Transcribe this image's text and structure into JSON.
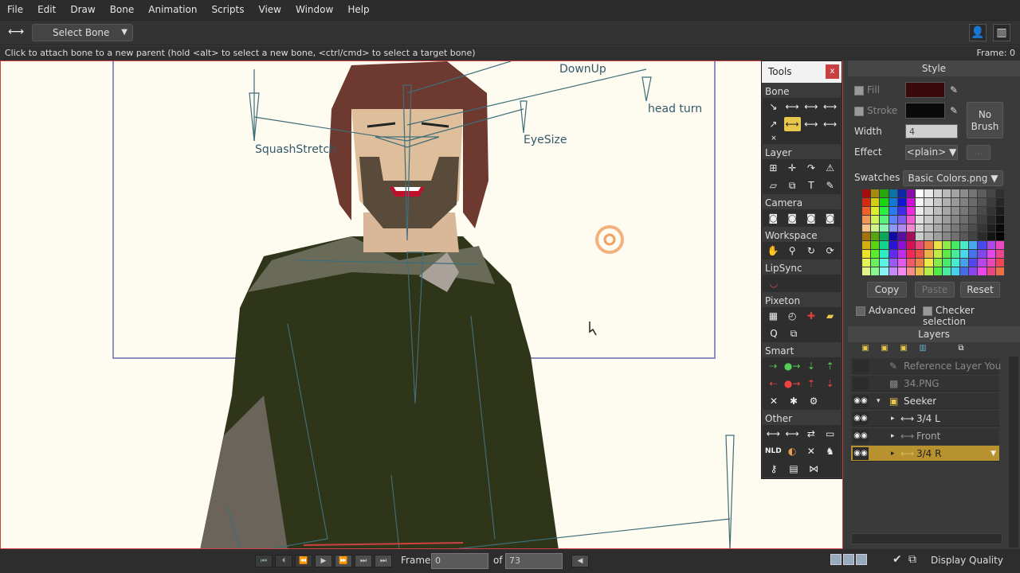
{
  "menu": [
    "File",
    "Edit",
    "Draw",
    "Bone",
    "Animation",
    "Scripts",
    "View",
    "Window",
    "Help"
  ],
  "toolbar": {
    "tool_select": "Select Bone"
  },
  "status": {
    "hint": "Click to attach bone to a new parent (hold <alt> to select a new bone, <ctrl/cmd> to select a target bone)",
    "frame": "Frame: 0"
  },
  "canvas": {
    "bone_labels": {
      "downup": "DownUp",
      "head_turn": "head turn",
      "squash": "SquashStretch",
      "eyesize": "EyeSize"
    }
  },
  "tools": {
    "title": "Tools",
    "close": "x",
    "sections": {
      "bone": "Bone",
      "layer": "Layer",
      "camera": "Camera",
      "workspace": "Workspace",
      "lipsync": "LipSync",
      "pixeton": "Pixeton",
      "smart": "Smart",
      "other": "Other"
    }
  },
  "style": {
    "title": "Style",
    "fill_label": "Fill",
    "stroke_label": "Stroke",
    "no_brush": "No Brush",
    "width_label": "Width",
    "width_value": "4",
    "effect_label": "Effect",
    "effect_value": "<plain>",
    "swatches_label": "Swatches",
    "swatches_value": "Basic Colors.png",
    "copy": "Copy",
    "paste": "Paste",
    "reset": "Reset",
    "advanced": "Advanced",
    "checker": "Checker selection",
    "fill_color": "#3a0a0a",
    "stroke_color": "#0a0a0a"
  },
  "layers": {
    "title": "Layers",
    "items": [
      {
        "name": "Reference Layer Young"
      },
      {
        "name": "34.PNG"
      },
      {
        "name": "Seeker"
      },
      {
        "name": "3/4 L"
      },
      {
        "name": "Front"
      },
      {
        "name": "3/4 R"
      }
    ]
  },
  "playback": {
    "frame_label": "Frame",
    "frame_value": "0",
    "of_label": "of",
    "of_value": "73",
    "display_quality": "Display Quality"
  },
  "colors": {
    "accent": "#e8c84a",
    "selected_layer": "#b8922e"
  }
}
